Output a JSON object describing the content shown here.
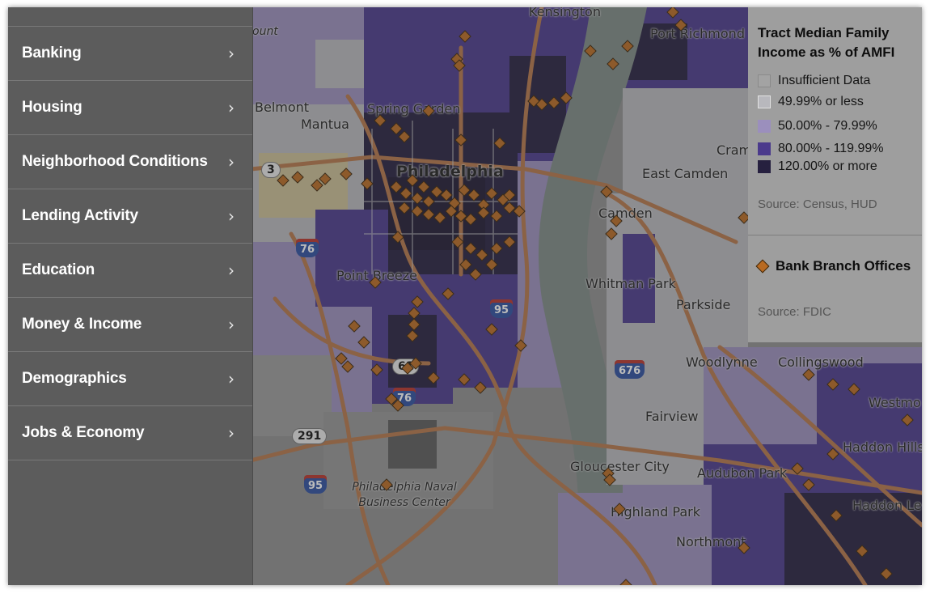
{
  "menu": {
    "items": [
      {
        "label": "Banking",
        "icon": "chevron-right-icon"
      },
      {
        "label": "Housing",
        "icon": "chevron-right-icon"
      },
      {
        "label": "Neighborhood Conditions",
        "icon": "chevron-right-icon"
      },
      {
        "label": "Lending Activity",
        "icon": "chevron-right-icon"
      },
      {
        "label": "Education",
        "icon": "chevron-right-icon"
      },
      {
        "label": "Money & Income",
        "icon": "chevron-right-icon"
      },
      {
        "label": "Demographics",
        "icon": "chevron-right-icon"
      },
      {
        "label": "Jobs & Economy",
        "icon": "chevron-right-icon"
      }
    ],
    "chevron_glyph": "›"
  },
  "legend": {
    "title": "Tract Median Family Income as % of AMFI",
    "items": [
      {
        "label": "Insufficient Data",
        "color": "#a3a3a3"
      },
      {
        "label": "49.99% or less",
        "color": "#b8b8bd"
      },
      {
        "label": "50.00% - 79.99%",
        "color": "#9b8fbd"
      },
      {
        "label": "80.00% - 119.99%",
        "color": "#4b3a8c"
      },
      {
        "label": "120.00% or more",
        "color": "#26203f"
      }
    ],
    "source_income": "Source: Census, HUD",
    "branch_label": "Bank Branch Offices",
    "branch_color": "#b86a22",
    "source_branch": "Source: FDIC"
  },
  "map": {
    "places": {
      "philadelphia": "Philadelphia",
      "camden": "Camden",
      "east_camden": "East Camden",
      "belmont": "Belmont",
      "mantua": "Mantua",
      "spring_garden": "Spring Garden",
      "point_breeze": "Point Breeze",
      "whitman_park": "Whitman Park",
      "parkside": "Parkside",
      "woodlynne": "Woodlynne",
      "collingswood": "Collingswood",
      "fairview": "Fairview",
      "gloucester_city": "Gloucester City",
      "audubon_park": "Audubon Park",
      "highland_park": "Highland Park",
      "northmont": "Northmont",
      "haddon_hills": "Haddon Hills",
      "haddon_le": "Haddon Le",
      "westmo": "Westmo",
      "port_richmond": "Port Richmond",
      "kensington": "Kensington",
      "cram": "Cram",
      "ount": "ount",
      "naval_business_center": "Philadelphia Naval Business Center"
    },
    "route_shields": {
      "r3": "3",
      "r76": "76",
      "r95a": "95",
      "r95b": "95",
      "r676": "676",
      "r61": "61",
      "r76b": "76",
      "r291": "291"
    }
  }
}
